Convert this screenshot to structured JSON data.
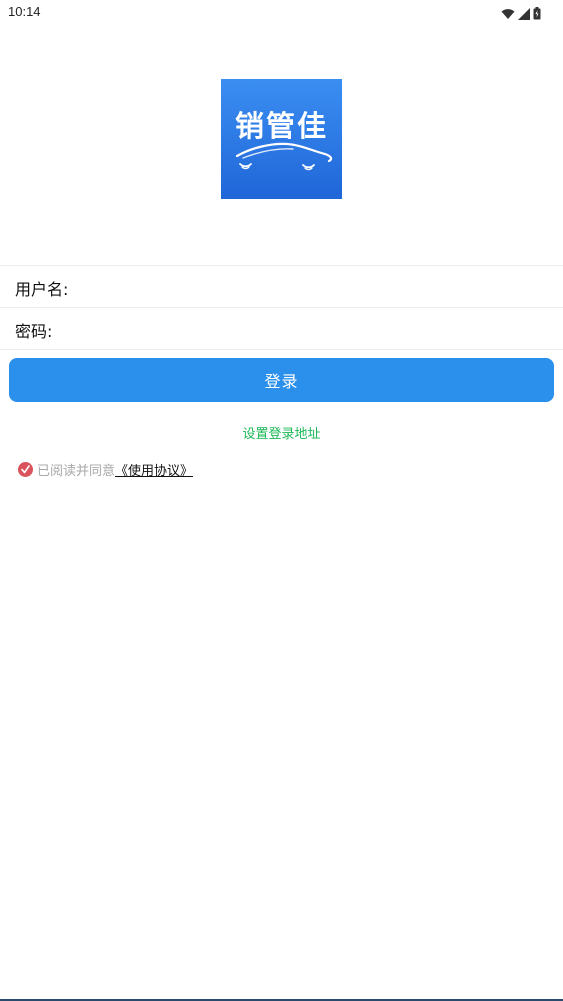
{
  "status_bar": {
    "time": "10:14",
    "icons": [
      "wifi-icon",
      "cell-signal-icon",
      "battery-icon"
    ]
  },
  "logo": {
    "text": "销管佳",
    "background": "#2b7ce9"
  },
  "form": {
    "username_label": "用户名:",
    "username_value": "",
    "password_label": "密码:",
    "password_value": ""
  },
  "login_button": {
    "label": "登录",
    "color": "#2b90ec"
  },
  "address_link": {
    "label": "设置登录地址",
    "color": "#1bb856"
  },
  "agreement": {
    "checked": true,
    "prefix": "已阅读并同意",
    "link": "《使用协议》",
    "check_color": "#d9525c"
  }
}
